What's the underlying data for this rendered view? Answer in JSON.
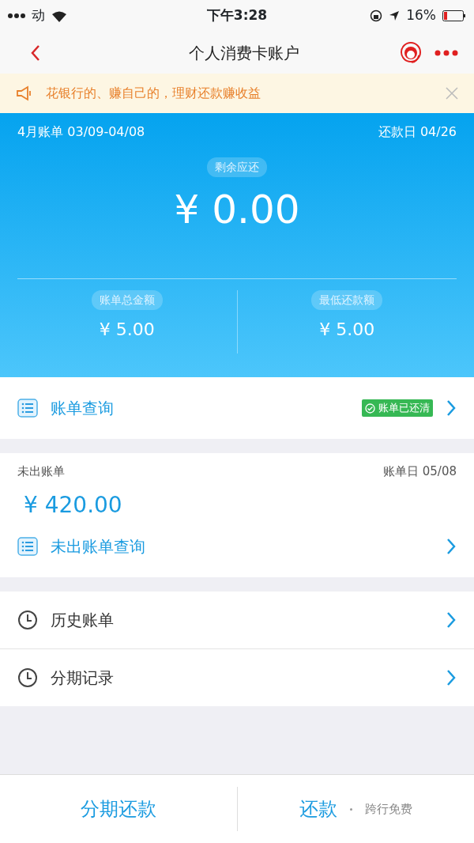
{
  "status_bar": {
    "carrier": "动",
    "time": "下午3:28",
    "battery": "16%"
  },
  "nav": {
    "title": "个人消费卡账户"
  },
  "notice": {
    "text": "花银行的、赚自己的，理财还款赚收益"
  },
  "bill": {
    "period": "4月账单 03/09-04/08",
    "due": "还款日 04/26",
    "remaining_label": "剩余应还",
    "remaining": "¥ 0.00",
    "stats": [
      {
        "label": "账单总金额",
        "value": "¥ 5.00"
      },
      {
        "label": "最低还款额",
        "value": "¥ 5.00"
      }
    ]
  },
  "query": {
    "label": "账单查询",
    "badge": "账单已还清"
  },
  "unbilled": {
    "title": "未出账单",
    "date": "账单日 05/08",
    "amount": "¥ 420.00",
    "link": "未出账单查询"
  },
  "menu": [
    {
      "label": "历史账单"
    },
    {
      "label": "分期记录"
    }
  ],
  "bottom": [
    {
      "label": "分期还款"
    },
    {
      "label": "还款",
      "note": "跨行免费"
    }
  ]
}
